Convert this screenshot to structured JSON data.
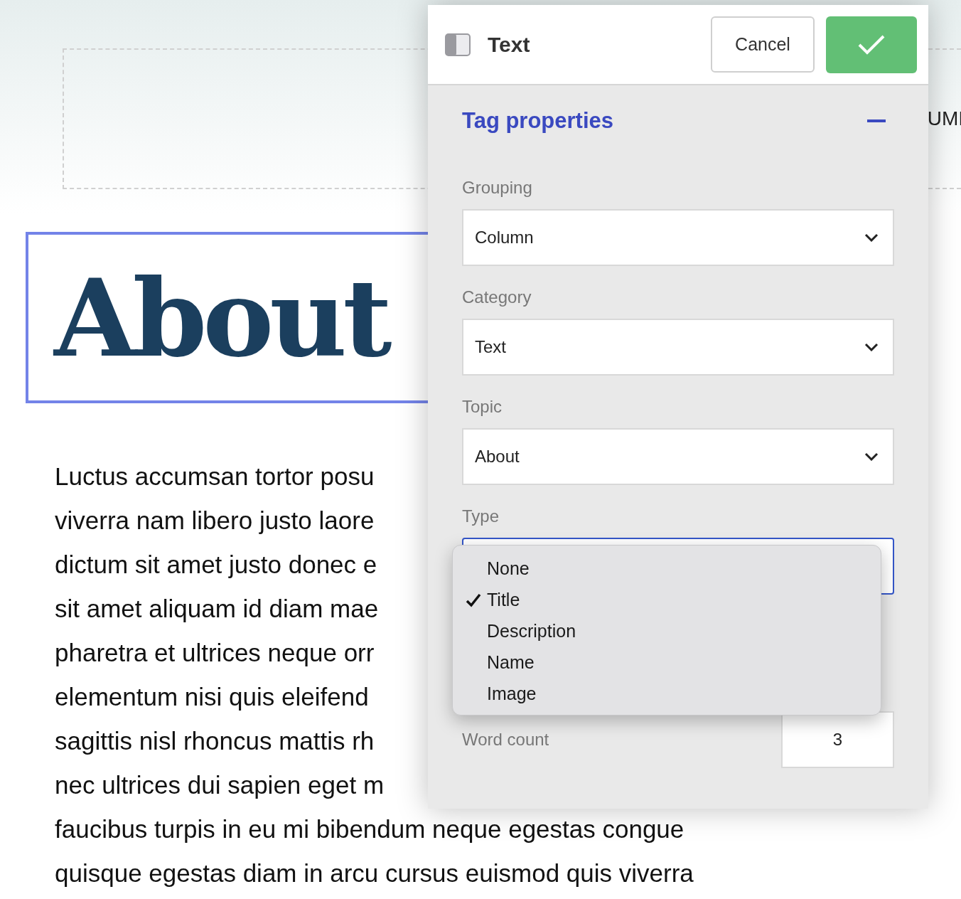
{
  "page": {
    "right_edge_text": "UMI",
    "heading": "About",
    "heading_selected": true,
    "paragraph_lines": [
      "Luctus accumsan tortor posu",
      "viverra nam libero justo laore",
      "dictum sit amet justo donec e",
      "sit amet aliquam id diam mae",
      "pharetra et ultrices neque orr",
      "elementum nisi quis eleifend",
      "sagittis nisl rhoncus mattis rh",
      "nec ultrices dui sapien eget m",
      "faucibus turpis in eu mi bibendum neque egestas congue",
      "quisque egestas diam in arcu cursus euismod quis viverra"
    ]
  },
  "panel": {
    "title": "Text",
    "cancel": "Cancel",
    "section": {
      "title": "Tag properties",
      "expanded": true
    },
    "fields": [
      {
        "label": "Grouping",
        "value": "Column"
      },
      {
        "label": "Category",
        "value": "Text"
      },
      {
        "label": "Topic",
        "value": "About"
      }
    ],
    "type_label": "Type",
    "word_count": {
      "label": "Word count",
      "value": "3"
    }
  },
  "type_menu": [
    {
      "label": "None",
      "selected": false
    },
    {
      "label": "Title",
      "selected": true
    },
    {
      "label": "Description",
      "selected": false
    },
    {
      "label": "Name",
      "selected": false
    },
    {
      "label": "Image",
      "selected": false
    }
  ]
}
